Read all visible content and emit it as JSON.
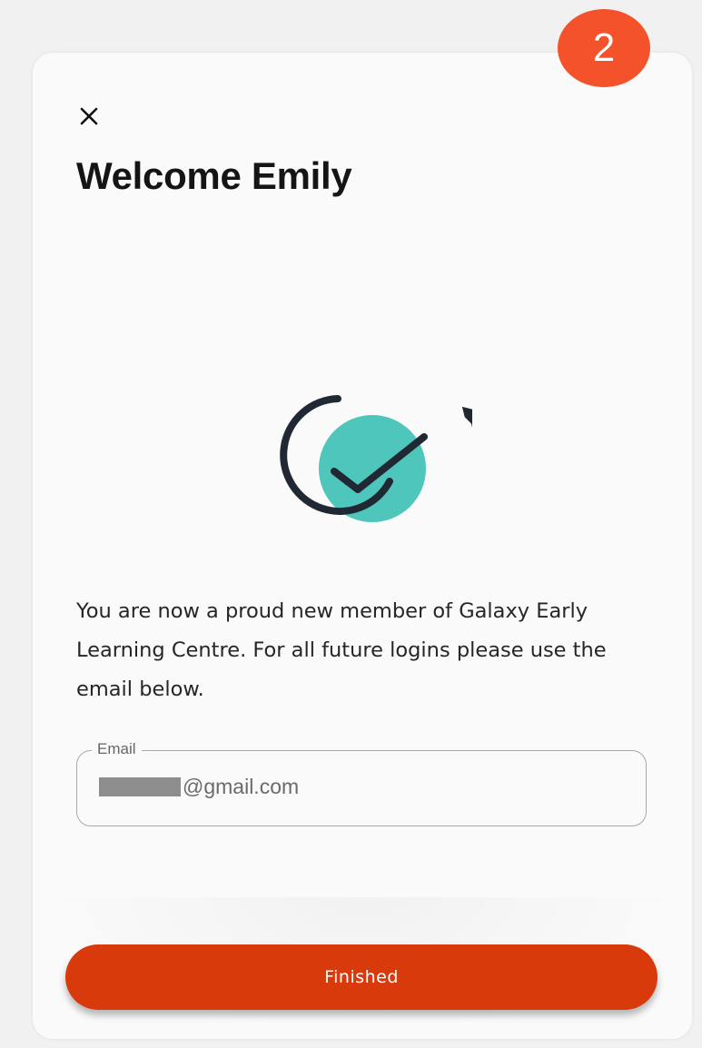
{
  "step_badge": "2",
  "dialog": {
    "title": "Welcome Emily",
    "message": "You are now a proud new member of Galaxy Early Learning Centre. For all future logins please use the email below.",
    "email_label": "Email",
    "email_value_suffix": "@gmail.com",
    "finish_label": "Finished"
  },
  "icons": {
    "close": "close-icon",
    "illustration": "check-rocket-icon"
  },
  "colors": {
    "accent": "#d93a0c",
    "badge": "#f4522b",
    "illustration_fill": "#4fc6bb",
    "illustration_stroke": "#202833"
  }
}
